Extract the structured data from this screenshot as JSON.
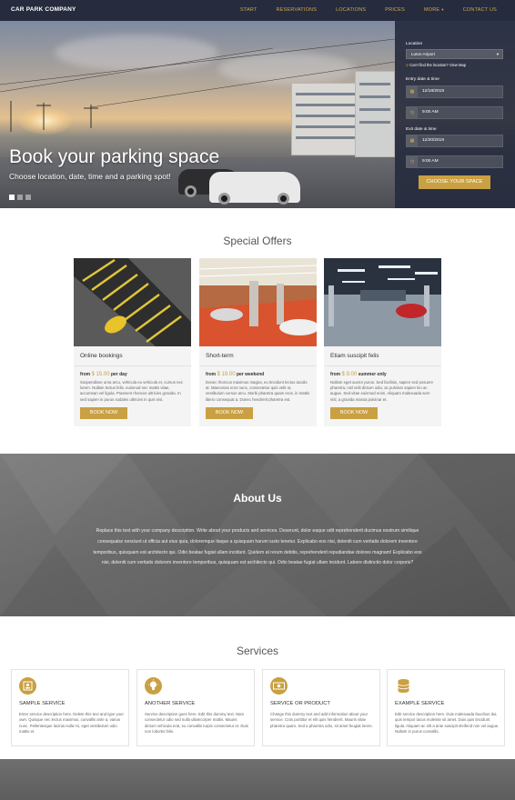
{
  "brand": "CAR PARK COMPANY",
  "nav": {
    "items": [
      "START",
      "RESERVATIONS",
      "LOCATIONS",
      "PRICES",
      "MORE",
      "CONTACT US"
    ],
    "more_caret": "▾"
  },
  "hero": {
    "title": "Book your parking space",
    "subtitle": "Choose location, date, time and a parking spot!",
    "active_slide": 1,
    "slide_count": 3
  },
  "booking": {
    "location_label": "Location",
    "location_value": "Luton Airport",
    "map_link": "Can't find the location? View Map",
    "entry_label": "Entry date & time",
    "entry_date": "12/18/2019",
    "entry_time": "9:00 AM",
    "exit_label": "Exit date & time",
    "exit_date": "12/20/2019",
    "exit_time": "9:00 AM",
    "button": "CHOOSE YOUR SPACE"
  },
  "offers": {
    "title": "Special Offers",
    "items": [
      {
        "name": "Online bookings",
        "price_prefix": "from",
        "price": "$ 15.00",
        "price_suffix": "per day",
        "desc": "Suspendisse urna arcu, vehicula eu vehicula et, cursus nec lorem. Nullam lectus felis, euismod nec mattis vitae, accumsan vel ligula. Praesent rhoncus ultricies gravida. In sed sapien in purus sodales ultricies in quis nisi.",
        "button": "BOOK NOW"
      },
      {
        "name": "Short-term",
        "price_prefix": "from",
        "price": "$ 19.00",
        "price_suffix": "per weekend",
        "desc": "Donec rhoncus maximus magna, eu tincidunt lectus iaculis at. Maecenas eros nunc, consectetur quis velit ut, vestibulum cursus arcu. Morbi pharetra quam eros, in mattis libero consequat a. Donec hendrerit pharetra est.",
        "button": "BOOK NOW"
      },
      {
        "name": "Etiam suscipit felis",
        "price_prefix": "from",
        "price": "$ 9.00",
        "price_suffix": "summer only",
        "desc": "Nullam eget auctor purus. Sed facilisis, sapien sed posuere pharetra, nisl velit dictum odio, ac pulvinar sapien leo ac augue. Sed vitae euismod enim. Aliquam malesuada sem nisl, a gravida massa pulvinar et.",
        "button": "BOOK NOW"
      }
    ]
  },
  "about": {
    "title": "About Us",
    "text": "Replace this text with your company description. Write about your products and services. Deserunt, dolor eaque odit reprehenderit ducimus nostrum similique consequatur nesciunt ut officia aut eius quia, doloremque itaque a quisquam harum iusto tenetur. Explicabo eos nisi, deleniti cum veritatis dolorem inventore temporibus, quisquam est architecto qui. Odio beatae fugiat ullam incidunt. Quidem at rerum debitis, reprehenderit repudiandae dolores magnam! Explicabo eos nisi, deleniti cum veritatis dolorem inventore temporibus, quisquam est architecto qui. Odio beatae fugiat ullam incidunt. Labore distinctio dolor corporis?"
  },
  "services": {
    "title": "Services",
    "items": [
      {
        "name": "SAMPLE SERVICE",
        "icon": "id-card-icon",
        "desc": "Enter service description here. Delete this text and type your own. Quisque nec lectus maximus, convallis ante a, varius nunc. Pellentesque lacinia nulla mi, eget vestibulum odio mattis et."
      },
      {
        "name": "ANOTHER SERVICE",
        "icon": "lightbulb-icon",
        "desc": "Service description goes here. Edit this dummy text. Nam consectetur odio sed nulla ullamcorper mattis. Mauris dictum vehicula erat, eu convallis turpis consectetur et. Duis non lobortis felis."
      },
      {
        "name": "SERVICE OR PRODUCT",
        "icon": "money-icon",
        "desc": "Change this dummy text and add information about your service. Cras porttitor et elit quis hendrerit. Mauris vitae pharetra quam. Sed a pharetra odio, sit amet feugiat lorem."
      },
      {
        "name": "EXAMPLE SERVICE",
        "icon": "database-icon",
        "desc": "Edit service description here. Duis malesuada faucibus dui, quis tempor lacus molestie sit amet. Duis quis tincidunt ligula. Aliquam ac elit a ante suscipit eleifend non vel augue. Nullam in purus convallis."
      }
    ]
  },
  "colors": {
    "nav_bg": "#262b3e",
    "accent": "#c9a042"
  }
}
